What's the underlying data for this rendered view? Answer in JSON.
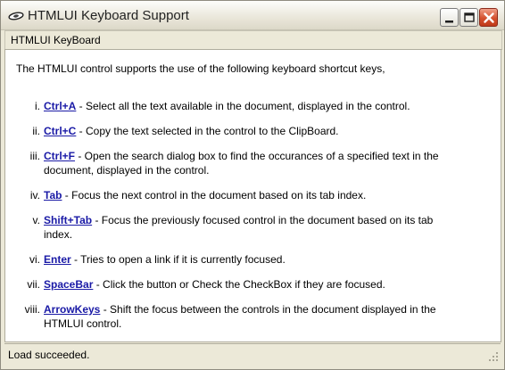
{
  "window": {
    "title": "HTMLUI Keyboard Support",
    "controls": {
      "minimize_icon": "minimize-icon",
      "maximize_icon": "maximize-icon",
      "close_icon": "close-icon"
    }
  },
  "tab": {
    "label": "HTMLUI KeyBoard"
  },
  "content": {
    "intro": "The HTMLUI control supports the use of the following keyboard shortcut keys,",
    "items": [
      {
        "num": "i.",
        "key": "Ctrl+A",
        "desc": " - Select all the text available in the document, displayed in the control."
      },
      {
        "num": "ii.",
        "key": "Ctrl+C",
        "desc": " - Copy the text selected in the control to the ClipBoard."
      },
      {
        "num": "iii.",
        "key": "Ctrl+F",
        "desc": " - Open the search dialog box to find the occurances of a specified text in the document, displayed in the control."
      },
      {
        "num": "iv.",
        "key": "Tab",
        "desc": " - Focus the next control in the document based on its tab index."
      },
      {
        "num": "v.",
        "key": "Shift+Tab",
        "desc": " - Focus the previously focused control in the document based on its tab index."
      },
      {
        "num": "vi.",
        "key": "Enter",
        "desc": " - Tries to open a link if it is currently focused."
      },
      {
        "num": "vii.",
        "key": "SpaceBar",
        "desc": " - Click the button or Check the CheckBox if they are focused."
      },
      {
        "num": "viii.",
        "key": "ArrowKeys",
        "desc": " - Shift the focus between the controls in the document displayed in the HTMLUI control."
      }
    ]
  },
  "status": {
    "text": "Load succeeded."
  },
  "colors": {
    "link": "#1a1aa6",
    "close_button": "#d4502e",
    "chrome": "#ece9d8"
  }
}
